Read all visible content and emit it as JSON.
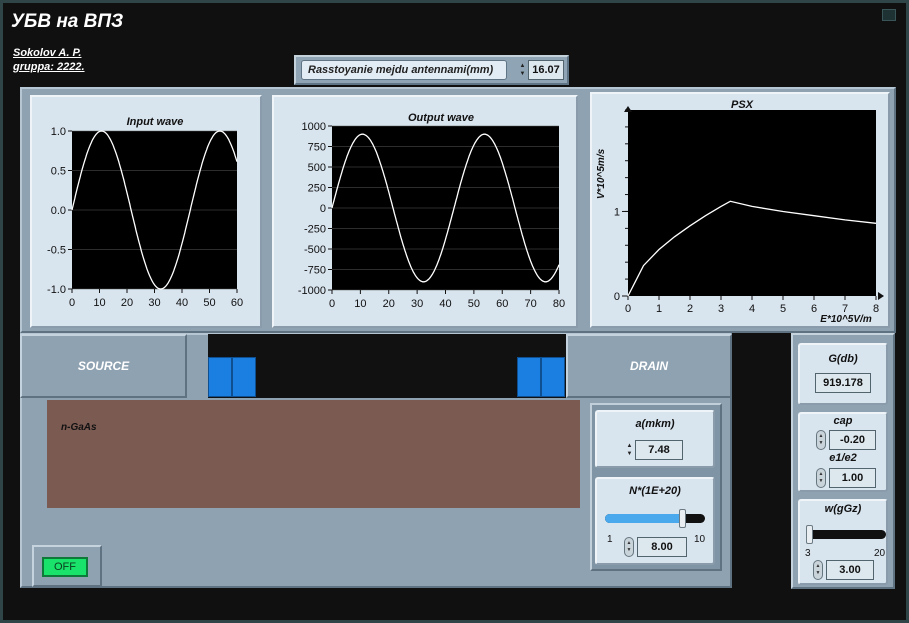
{
  "window": {
    "title": "УБВ на ВПЗ"
  },
  "author": {
    "line1": "Sokolov A. P.",
    "line2": "gruppa: 2222."
  },
  "antenna_distance": {
    "label": "Rasstoyanie mejdu antennami(mm)",
    "value": "16.07"
  },
  "colors": {
    "plot_bg": "#000000",
    "trace": "#ffffff",
    "metal": "#1a7fe0",
    "substrate": "#7b5a52",
    "led": "#19e36a"
  },
  "charts": {
    "input": {
      "title": "Input wave",
      "x_ticks": [
        "0",
        "10",
        "20",
        "30",
        "40",
        "50",
        "60"
      ],
      "y_ticks": [
        "1.0",
        "0.5",
        "0.0",
        "-0.5",
        "-1.0"
      ]
    },
    "output": {
      "title": "Output wave",
      "x_ticks": [
        "0",
        "10",
        "20",
        "30",
        "40",
        "50",
        "60",
        "70",
        "80"
      ],
      "y_ticks": [
        "1000",
        "750",
        "500",
        "250",
        "0",
        "-250",
        "-500",
        "-750",
        "-1000"
      ]
    },
    "psx": {
      "title": "PSX",
      "xlabel": "E*10^5V/m",
      "ylabel": "V*10^5m/s",
      "x_ticks": [
        "0",
        "1",
        "2",
        "3",
        "4",
        "5",
        "6",
        "7",
        "8"
      ],
      "y_ticks": [
        "0",
        "1"
      ]
    }
  },
  "chart_data": [
    {
      "type": "line",
      "title": "Input wave",
      "xlim": [
        0,
        60
      ],
      "ylim": [
        -1,
        1
      ],
      "amplitude": 1.0,
      "period": 43,
      "series": [
        {
          "x": [
            0,
            5,
            10,
            15,
            20,
            25,
            30,
            35,
            40,
            45,
            50,
            55,
            60
          ],
          "values": [
            0.0,
            0.66,
            0.99,
            0.75,
            0.16,
            -0.53,
            -0.97,
            -0.84,
            -0.32,
            0.39,
            0.91,
            0.93,
            0.51
          ]
        }
      ]
    },
    {
      "type": "line",
      "title": "Output wave",
      "xlim": [
        0,
        80
      ],
      "ylim": [
        -1000,
        1000
      ],
      "amplitude": 900,
      "period": 43,
      "series": [
        {
          "x": [
            0,
            10,
            20,
            30,
            40,
            50,
            60,
            70,
            80
          ],
          "values": [
            0,
            891,
            262,
            -820,
            -510,
            678,
            722,
            -454,
            -628
          ]
        }
      ]
    },
    {
      "type": "line",
      "title": "PSX",
      "xlabel": "E*10^5V/m",
      "ylabel": "V*10^5m/s",
      "xlim": [
        0,
        8
      ],
      "ylim": [
        0,
        2.2
      ],
      "series": [
        {
          "x": [
            0,
            0.5,
            1.0,
            1.5,
            2.0,
            2.5,
            3.0,
            3.3,
            4.0,
            5.0,
            6.0,
            7.0,
            8.0
          ],
          "values": [
            0.0,
            0.36,
            0.55,
            0.7,
            0.83,
            0.95,
            1.06,
            1.12,
            1.06,
            1.0,
            0.95,
            0.9,
            0.86
          ]
        }
      ]
    }
  ],
  "device": {
    "source": "SOURCE",
    "drain": "DRAIN",
    "substrate": "n-GaAs"
  },
  "power": {
    "label": "OFF"
  },
  "a": {
    "label": "a(mkm)",
    "value": "7.48"
  },
  "N": {
    "label": "N*(1E+20)",
    "min": "1",
    "max": "10",
    "value": "8.00",
    "level": 0.8
  },
  "G": {
    "label": "G(db)",
    "value": "919.178"
  },
  "cap": {
    "label": "cap",
    "value": "-0.20"
  },
  "e": {
    "label": "e1/e2",
    "value": "1.00"
  },
  "w": {
    "label": "w(gGz)",
    "min": "3",
    "max": "20",
    "value": "3.00",
    "level": 0.0
  }
}
